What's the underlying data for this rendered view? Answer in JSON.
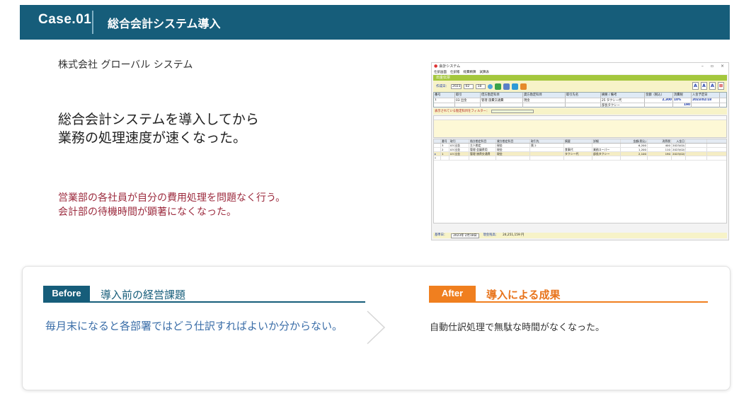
{
  "header": {
    "case_label": "Case.01",
    "title": "総合会計システム導入"
  },
  "company": "株式会社 グローバル システム",
  "headline": {
    "line1": "総合会計システムを導入してから",
    "line2": "業務の処理速度が速くなった。"
  },
  "description": {
    "line1": "営業部の各社員が自分の費用処理を問題なく行う。",
    "line2": "会計部の待機時間が顕著になくなった。"
  },
  "app": {
    "window_title": "会計システム",
    "menu": [
      "仕訳画面",
      "仕訳帳",
      "経費精算",
      "試算表"
    ],
    "section_title": "出金伝票",
    "toolbar": {
      "date_label": "作成日：",
      "year": "2023",
      "month": "02",
      "day": "18",
      "font_buttons": [
        "A",
        "A",
        "A"
      ]
    },
    "form": {
      "headers": [
        "番号",
        "取引",
        "借方勘定科目",
        "貸方勘定科目",
        "取引先名",
        "摘要 / 備考",
        "金額（税込）",
        "消費税",
        "入金予定日"
      ],
      "row1": [
        "1",
        "03 出金",
        "管理 旅費交通費",
        "現金",
        "",
        "25 タクシー代",
        "2,300",
        "10%",
        "2023/02/18"
      ],
      "row2": [
        "",
        "",
        "",
        "",
        "",
        "部長タクシー",
        "",
        "190",
        ""
      ]
    },
    "filter_label": "表示されている勘定科目をフィルター：",
    "list": {
      "headers": [
        "",
        "番号",
        "取引",
        "借方勘定科目",
        "貸方勘定科目",
        "取引先",
        "摘要",
        "詳細",
        "金額(税込)",
        "消費税",
        "入金日"
      ],
      "rows": [
        [
          "",
          "3",
          "03 出金",
          "主人勘定",
          "現金",
          "属 2",
          "",
          "",
          "6,200",
          "400",
          "2023/02/18"
        ],
        [
          "",
          "2",
          "03 出金",
          "管理 会議費用",
          "現金",
          "",
          "食事代",
          "業務スーパー",
          "1,200",
          "110",
          "2023/02/18"
        ],
        [
          "▸",
          "1",
          "03 出金",
          "管理 旅費交通費",
          "現金",
          "",
          "タクシー代",
          "部長タクシー",
          "2,100",
          "190",
          "2023/02/18"
        ],
        [
          "*",
          "",
          "",
          "",
          "",
          "",
          "",
          "",
          "",
          "",
          ""
        ]
      ]
    },
    "status": {
      "date_label": "基準日：",
      "date_value": "2023年 2月18日",
      "balance_label": "現金残高：",
      "balance_value": "24,251,159 円"
    }
  },
  "before": {
    "tag": "Before",
    "title": "導入前の経営課題",
    "text": "毎月末になると各部署ではどう仕訳すればよいか分からない。"
  },
  "after": {
    "tag": "After",
    "title": "導入による成果",
    "text": "自動仕訳処理で無駄な時間がなくなった。"
  },
  "colors": {
    "brand": "#165d7a",
    "accent": "#f07f1f",
    "description": "#9c2b3e",
    "before_text": "#3b6ea8"
  }
}
